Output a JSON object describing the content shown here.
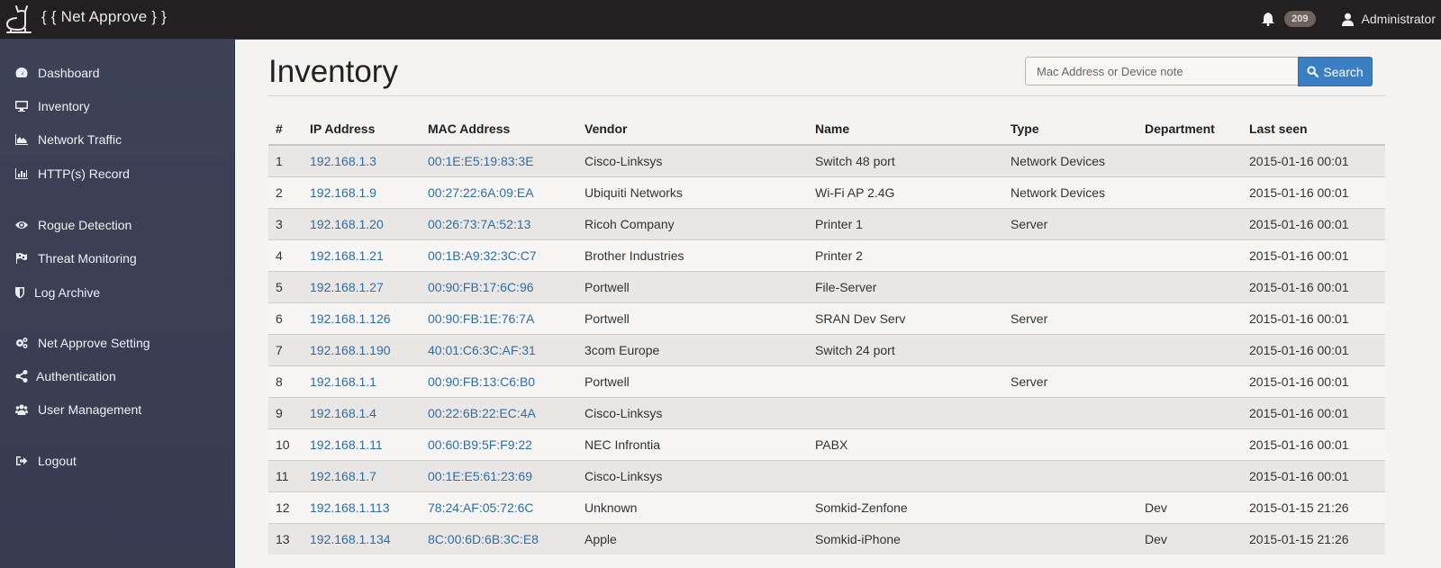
{
  "app": {
    "brand": "{ { Net Approve } }",
    "notifications_count": "209",
    "user_name": "Administrator",
    "accent_color": "#3a7fc4",
    "link_color": "#2e6da4"
  },
  "sidebar": {
    "items": [
      {
        "label": "Dashboard",
        "icon": "dashboard-icon"
      },
      {
        "label": "Inventory",
        "icon": "monitor-icon"
      },
      {
        "label": "Network Traffic",
        "icon": "area-chart-icon"
      },
      {
        "label": "HTTP(s) Record",
        "icon": "bar-chart-icon"
      },
      {
        "label": "Rogue Detection",
        "icon": "eye-icon"
      },
      {
        "label": "Threat Monitoring",
        "icon": "flag-checkered-icon"
      },
      {
        "label": "Log Archive",
        "icon": "shield-icon"
      },
      {
        "label": "Net Approve Setting",
        "icon": "gears-icon"
      },
      {
        "label": "Authentication",
        "icon": "share-icon"
      },
      {
        "label": "User Management",
        "icon": "users-icon"
      },
      {
        "label": "Logout",
        "icon": "sign-out-icon"
      }
    ]
  },
  "main": {
    "title": "Inventory",
    "search": {
      "placeholder": "Mac Address or Device note",
      "value": "",
      "button_label": "Search"
    },
    "table": {
      "columns": [
        "#",
        "IP Address",
        "MAC Address",
        "Vendor",
        "Name",
        "Type",
        "Department",
        "Last seen"
      ],
      "rows": [
        {
          "num": "1",
          "ip": "192.168.1.3",
          "mac": "00:1E:E5:19:83:3E",
          "vendor": "Cisco-Linksys",
          "name": "Switch 48 port",
          "type": "Network Devices",
          "department": "",
          "last_seen": "2015-01-16 00:01"
        },
        {
          "num": "2",
          "ip": "192.168.1.9",
          "mac": "00:27:22:6A:09:EA",
          "vendor": "Ubiquiti Networks",
          "name": "Wi-Fi AP 2.4G",
          "type": "Network Devices",
          "department": "",
          "last_seen": "2015-01-16 00:01"
        },
        {
          "num": "3",
          "ip": "192.168.1.20",
          "mac": "00:26:73:7A:52:13",
          "vendor": "Ricoh Company",
          "name": "Printer 1",
          "type": "Server",
          "department": "",
          "last_seen": "2015-01-16 00:01"
        },
        {
          "num": "4",
          "ip": "192.168.1.21",
          "mac": "00:1B:A9:32:3C:C7",
          "vendor": "Brother Industries",
          "name": "Printer 2",
          "type": "",
          "department": "",
          "last_seen": "2015-01-16 00:01"
        },
        {
          "num": "5",
          "ip": "192.168.1.27",
          "mac": "00:90:FB:17:6C:96",
          "vendor": "Portwell",
          "name": "File-Server",
          "type": "",
          "department": "",
          "last_seen": "2015-01-16 00:01"
        },
        {
          "num": "6",
          "ip": "192.168.1.126",
          "mac": "00:90:FB:1E:76:7A",
          "vendor": "Portwell",
          "name": "SRAN Dev Serv",
          "type": "Server",
          "department": "",
          "last_seen": "2015-01-16 00:01"
        },
        {
          "num": "7",
          "ip": "192.168.1.190",
          "mac": "40:01:C6:3C:AF:31",
          "vendor": "3com Europe",
          "name": "Switch 24 port",
          "type": "",
          "department": "",
          "last_seen": "2015-01-16 00:01"
        },
        {
          "num": "8",
          "ip": "192.168.1.1",
          "mac": "00:90:FB:13:C6:B0",
          "vendor": "Portwell",
          "name": "",
          "type": "Server",
          "department": "",
          "last_seen": "2015-01-16 00:01"
        },
        {
          "num": "9",
          "ip": "192.168.1.4",
          "mac": "00:22:6B:22:EC:4A",
          "vendor": "Cisco-Linksys",
          "name": "",
          "type": "",
          "department": "",
          "last_seen": "2015-01-16 00:01"
        },
        {
          "num": "10",
          "ip": "192.168.1.11",
          "mac": "00:60:B9:5F:F9:22",
          "vendor": "NEC Infrontia",
          "name": "PABX",
          "type": "",
          "department": "",
          "last_seen": "2015-01-16 00:01"
        },
        {
          "num": "11",
          "ip": "192.168.1.7",
          "mac": "00:1E:E5:61:23:69",
          "vendor": "Cisco-Linksys",
          "name": "",
          "type": "",
          "department": "",
          "last_seen": "2015-01-16 00:01"
        },
        {
          "num": "12",
          "ip": "192.168.1.113",
          "mac": "78:24:AF:05:72:6C",
          "vendor": "Unknown",
          "name": "Somkid-Zenfone",
          "type": "",
          "department": "Dev",
          "last_seen": "2015-01-15 21:26"
        },
        {
          "num": "13",
          "ip": "192.168.1.134",
          "mac": "8C:00:6D:6B:3C:E8",
          "vendor": "Apple",
          "name": "Somkid-iPhone",
          "type": "",
          "department": "Dev",
          "last_seen": "2015-01-15 21:26"
        }
      ]
    }
  }
}
